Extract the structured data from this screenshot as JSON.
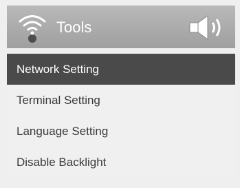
{
  "header": {
    "title": "Tools",
    "left_icon": "wifi-antenna-icon",
    "right_icon": "speaker-volume-icon"
  },
  "menu": {
    "items": [
      {
        "label": "Network Setting",
        "selected": true
      },
      {
        "label": "Terminal Setting",
        "selected": false
      },
      {
        "label": "Language Setting",
        "selected": false
      },
      {
        "label": "Disable Backlight",
        "selected": false
      }
    ]
  },
  "colors": {
    "header_bg": "#a8a8a8",
    "selected_bg": "#4a4a4a",
    "menu_bg": "#f0f0f0"
  }
}
